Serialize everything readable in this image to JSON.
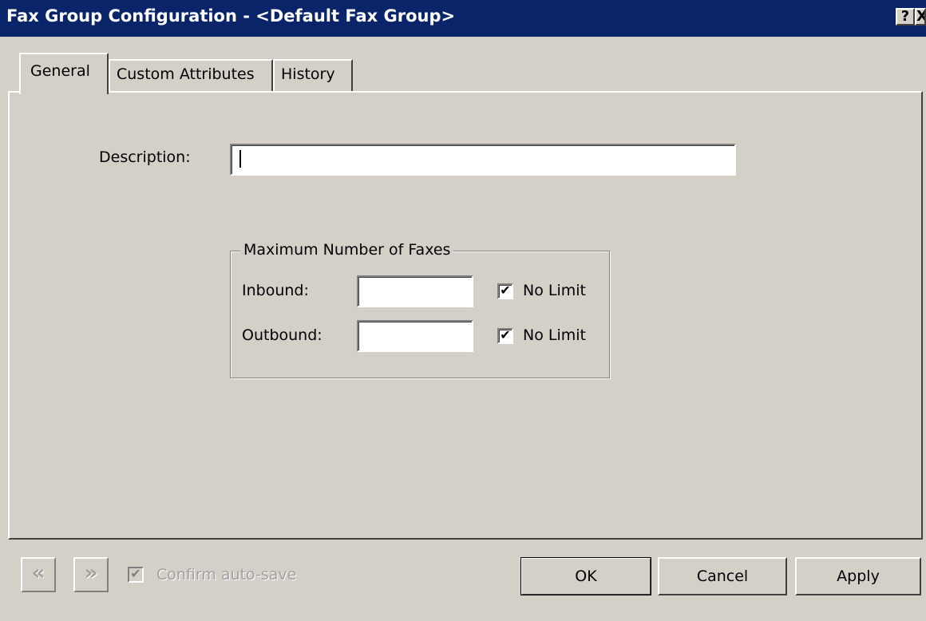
{
  "window": {
    "title": "Fax Group Configuration - <Default Fax Group>",
    "help_label": "?",
    "close_label": "X"
  },
  "tabs": [
    {
      "label": "General",
      "selected": true
    },
    {
      "label": "Custom Attributes",
      "selected": false
    },
    {
      "label": "History",
      "selected": false
    }
  ],
  "general": {
    "description_label": "Description:",
    "description_value": "",
    "max_faxes": {
      "legend": "Maximum Number of Faxes",
      "inbound_label": "Inbound:",
      "inbound_value": "",
      "inbound_no_limit_label": "No Limit",
      "inbound_no_limit_checked": true,
      "inbound_no_limit_mark": "✔",
      "outbound_label": "Outbound:",
      "outbound_value": "",
      "outbound_no_limit_label": "No Limit",
      "outbound_no_limit_checked": true,
      "outbound_no_limit_mark": "✔"
    }
  },
  "footer": {
    "prev_glyph": "«",
    "next_glyph": "»",
    "confirm_auto_save_label": "Confirm auto-save",
    "confirm_auto_save_mark": "✔",
    "ok_label": "OK",
    "cancel_label": "Cancel",
    "apply_label": "Apply"
  },
  "colors": {
    "titlebar": "#0a246a",
    "face": "#d4d0c8"
  }
}
